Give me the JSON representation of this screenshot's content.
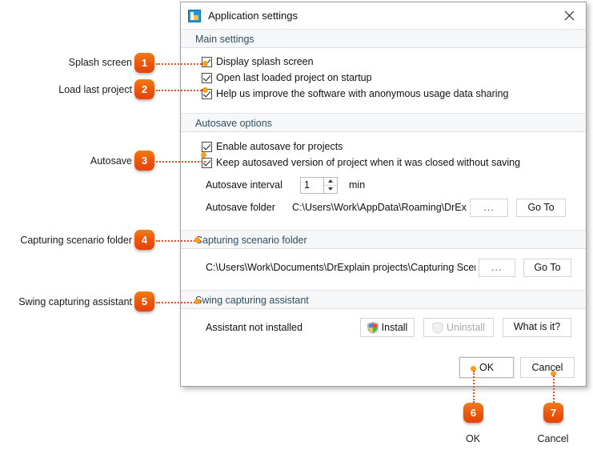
{
  "dialog": {
    "title": "Application settings",
    "icon": "app-settings-icon",
    "close_icon": "close-icon",
    "sections": {
      "main": {
        "header": "Main settings",
        "checkboxes": [
          {
            "label": "Display splash screen",
            "checked": true
          },
          {
            "label": "Open last loaded project on startup",
            "checked": true
          },
          {
            "label": "Help us improve the software with anonymous usage data sharing",
            "checked": true
          }
        ]
      },
      "autosave": {
        "header": "Autosave options",
        "checkboxes": [
          {
            "label": "Enable autosave for projects",
            "checked": true
          },
          {
            "label": "Keep autosaved version of project when it was closed without saving",
            "checked": true
          }
        ],
        "interval_label": "Autosave interval",
        "interval_value": "1",
        "interval_unit": "min",
        "folder_label": "Autosave folder",
        "folder_path": "C:\\Users\\Work\\AppData\\Roaming\\DrExplain",
        "browse_label": "...",
        "goto_label": "Go To"
      },
      "capturing": {
        "header": "Capturing scenario folder",
        "folder_path": "C:\\Users\\Work\\Documents\\DrExplain projects\\Capturing Scenarios",
        "browse_label": "...",
        "goto_label": "Go To"
      },
      "swing": {
        "header": "Swing capturing assistant",
        "status": "Assistant not installed",
        "install_label": "Install",
        "uninstall_label": "Uninstall",
        "what_is_it_label": "What is it?"
      }
    },
    "footer": {
      "ok_label": "OK",
      "cancel_label": "Cancel"
    }
  },
  "annotations": {
    "accent_color": "#ec5a0c",
    "line_color": "#f04a1e",
    "dot_color": "#f8a01c",
    "callouts": [
      {
        "number": "1",
        "label": "Splash screen"
      },
      {
        "number": "2",
        "label": "Load last project"
      },
      {
        "number": "3",
        "label": "Autosave"
      },
      {
        "number": "4",
        "label": "Capturing scenario folder"
      },
      {
        "number": "5",
        "label": "Swing capturing assistant"
      },
      {
        "number": "6",
        "label": "OK"
      },
      {
        "number": "7",
        "label": "Cancel"
      }
    ]
  }
}
